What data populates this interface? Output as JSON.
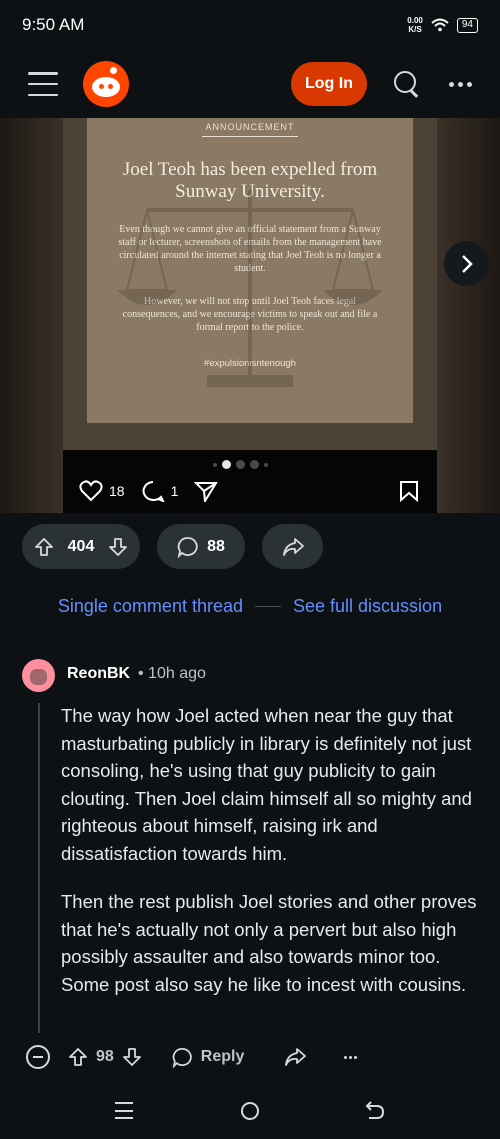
{
  "status_bar": {
    "time": "9:50 AM",
    "net_speed_value": "0.00",
    "net_speed_unit": "K/S",
    "battery": "94"
  },
  "header": {
    "login_label": "Log In",
    "icons": [
      "menu-icon",
      "reddit-logo",
      "search-icon",
      "more-icon"
    ],
    "accent": "#d93900"
  },
  "post_image": {
    "tag": "ANNOUNCEMENT",
    "title": "Joel Teoh has been expelled from Sunway University.",
    "paragraph1": "Even though we cannot give an official statement from a Sunway staff or lecturer, screenshots of emails from the management have circulated around the internet stating that Joel Teoh is no longer a student.",
    "paragraph2": "However, we will not stop until Joel Teoh faces legal consequences, and we encourage victims to speak out and file a formal report to the police.",
    "hashtag": "#expulsionisntenough",
    "likes": "18",
    "comments": "1",
    "carousel_index": 2,
    "carousel_total": 5
  },
  "post_actions": {
    "score": "404",
    "comments": "88"
  },
  "thread": {
    "single_label": "Single comment thread",
    "full_label": "See full discussion",
    "link_color": "#648efc"
  },
  "comment": {
    "author": "ReonBK",
    "time": "• 10h ago",
    "paragraph1": "The way how Joel acted when near the guy that masturbating publicly in library is definitely not just consoling, he's using that guy publicity to gain clouting. Then Joel claim himself all so mighty and righteous about himself, raising irk and dissatisfaction towards him.",
    "paragraph2": "Then the rest publish Joel stories and other proves that he's actually not only a pervert but also high possibly assaulter and also towards minor too. Some post also say he like to incest with cousins.",
    "score": "98",
    "reply_label": "Reply"
  }
}
